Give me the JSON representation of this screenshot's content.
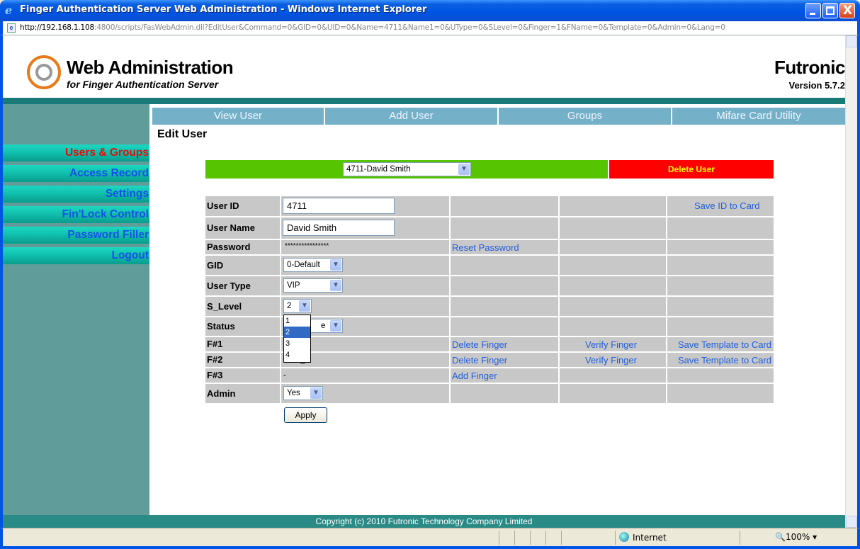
{
  "window": {
    "title": "Finger Authentication Server Web Administration - Windows Internet Explorer",
    "url_host": "http://192.168.1.108",
    "url_rest": ":4800/scripts/FasWebAdmin.dll?EditUser&Command=0&GID=0&UID=0&Name=4711&Name1=0&UType=0&SLevel=0&Finger=1&FName=0&Template=0&Admin=0&Lang=0",
    "close_glyph": "X"
  },
  "header": {
    "title": "Web Administration",
    "subtitle": "for Finger Authentication Server",
    "brand": "Futronic",
    "version": "Version 5.7.2"
  },
  "sidebar": {
    "items": [
      {
        "label": "Users & Groups",
        "active": true
      },
      {
        "label": "Access Record"
      },
      {
        "label": "Settings"
      },
      {
        "label": "Fin'Lock Control"
      },
      {
        "label": "Password Filler"
      },
      {
        "label": "Logout"
      }
    ]
  },
  "nav": {
    "tabs": [
      "View User",
      "Add User",
      "Groups",
      "Mifare Card Utility"
    ]
  },
  "page": {
    "heading": "Edit User",
    "user_select": "4711-David Smith",
    "delete_user": "Delete User"
  },
  "form": {
    "user_id_label": "User ID",
    "user_id_value": "4711",
    "save_id_to_card": "Save ID to Card",
    "user_name_label": "User Name",
    "user_name_value": "David Smith",
    "password_label": "Password",
    "password_mask": "****************",
    "reset_password": "Reset Password",
    "gid_label": "GID",
    "gid_value": "0-Default",
    "user_type_label": "User Type",
    "user_type_value": "VIP",
    "s_level_label": "S_Level",
    "s_level_value": "2",
    "s_level_options": [
      "1",
      "2",
      "3",
      "4"
    ],
    "status_label": "Status",
    "status_partial": "e",
    "f1_label": "F#1",
    "f2_label": "F#2",
    "f2_partial": "r_2",
    "f3_label": "F#3",
    "f3_value": "-",
    "delete_finger": "Delete Finger",
    "verify_finger": "Verify Finger",
    "save_template_to_card": "Save Template to Card",
    "add_finger": "Add Finger",
    "admin_label": "Admin",
    "admin_value": "Yes",
    "apply": "Apply"
  },
  "footer": {
    "copyright": "Copyright (c) 2010 Futronic Technology Company Limited"
  },
  "statusbar": {
    "zone": "Internet",
    "zoom": "100%"
  },
  "colors": {
    "sidebar_active": "#e0100c",
    "sidebar_link": "#1550e8",
    "delete_bg": "#ff0000",
    "delete_text": "#ffff00",
    "select_strip": "#57c400"
  }
}
